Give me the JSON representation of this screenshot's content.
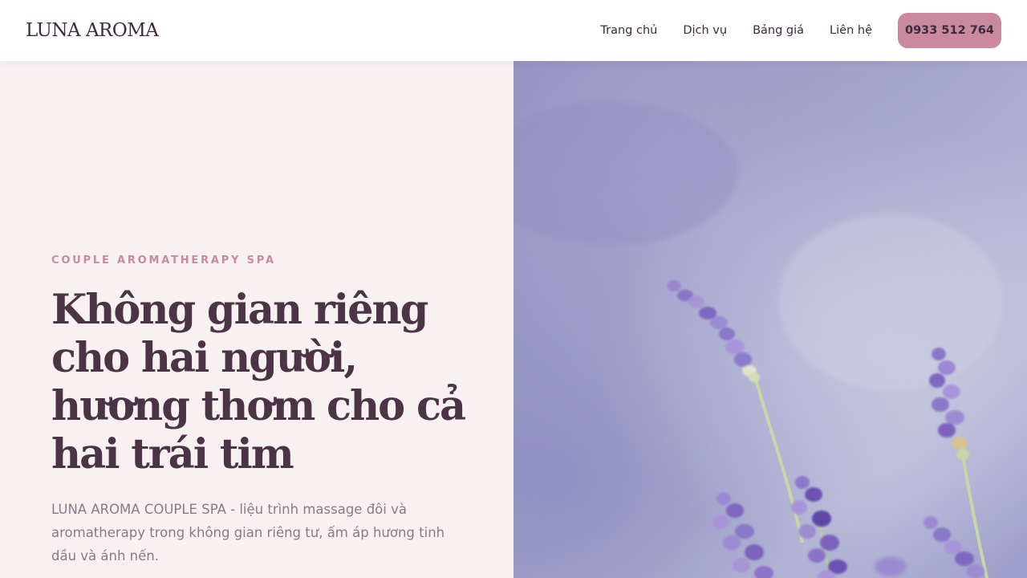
{
  "brand": {
    "logo": "LUNA AROMA"
  },
  "nav": {
    "items": [
      {
        "label": "Trang chủ"
      },
      {
        "label": "Dịch vụ"
      },
      {
        "label": "Bảng giá"
      },
      {
        "label": "Liên hệ"
      }
    ],
    "phone": "0933 512 764"
  },
  "hero": {
    "eyebrow": "COUPLE AROMATHERAPY SPA",
    "headline": "Không gian riêng cho hai người, hương thơm cho cả hai trái tim",
    "description": "LUNA AROMA COUPLE SPA - liệu trình massage đôi và aromatherapy trong không gian riêng tư, ấm áp hương tinh dầu và ánh nến.",
    "image": "lavender-flowers-photo"
  },
  "colors": {
    "accent": "#c9899f",
    "heading": "#4a3445",
    "hero_bg": "#f8f1f2",
    "text_muted": "#8a7a88"
  }
}
